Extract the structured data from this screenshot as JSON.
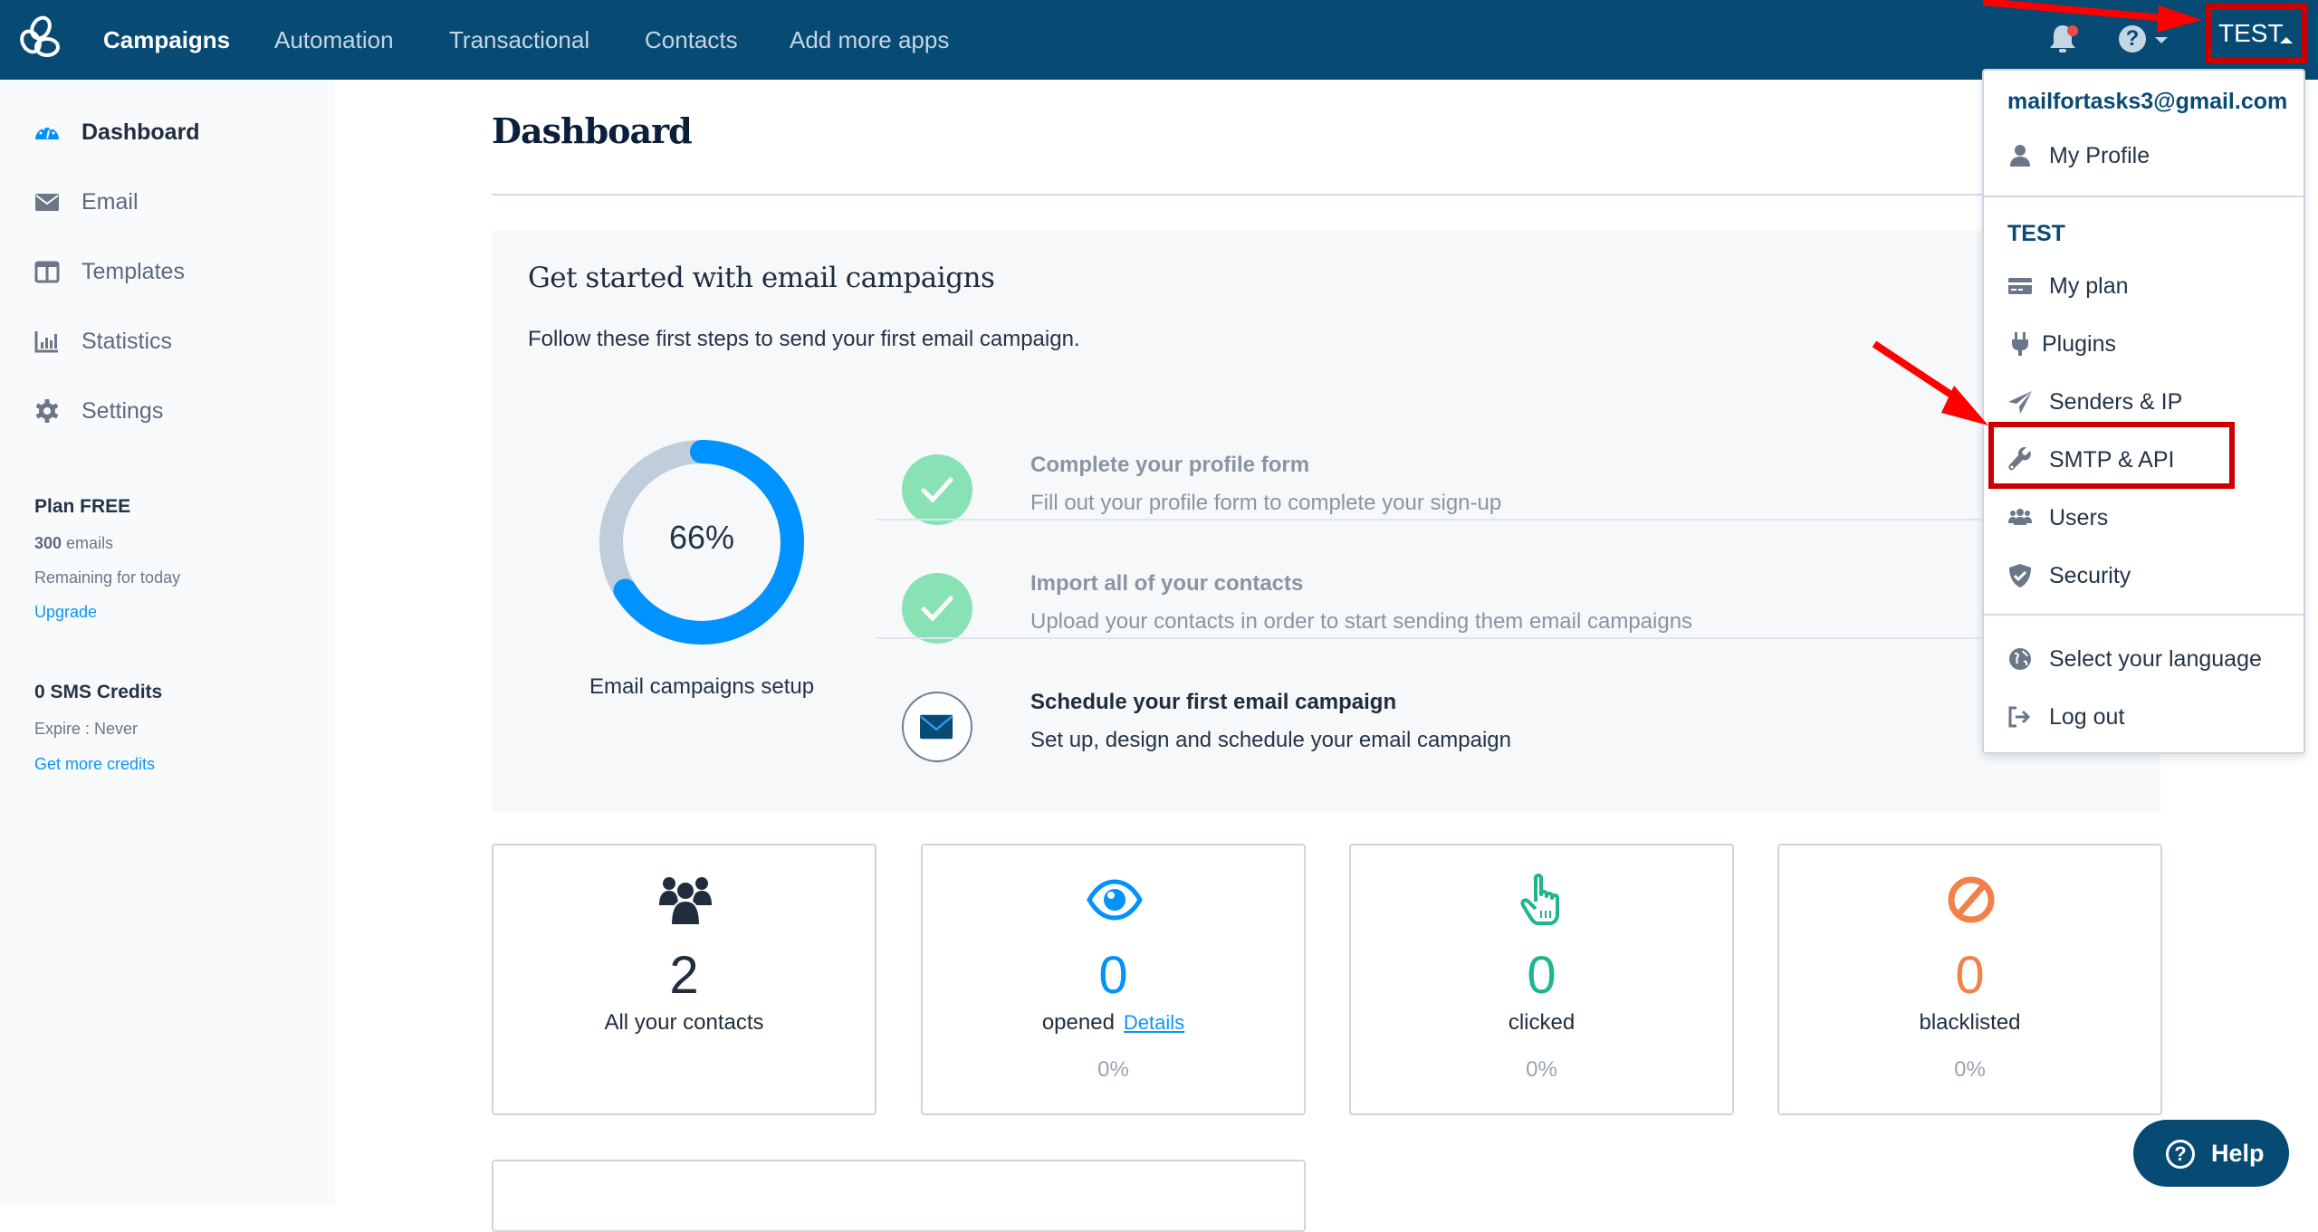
{
  "header": {
    "logo": "sendinblue-logo-icon",
    "nav": [
      {
        "label": "Campaigns",
        "active": true
      },
      {
        "label": "Automation",
        "active": false
      },
      {
        "label": "Transactional",
        "active": false
      },
      {
        "label": "Contacts",
        "active": false
      },
      {
        "label": "Add more apps",
        "active": false
      }
    ],
    "notifications_icon": "bell-icon",
    "help_icon": "question-circle-icon",
    "help_glyph": "?",
    "account_label": "TEST"
  },
  "sidebar": {
    "items": [
      {
        "label": "Dashboard",
        "icon": "dashboard-gauge-icon",
        "active": true
      },
      {
        "label": "Email",
        "icon": "envelope-icon",
        "active": false
      },
      {
        "label": "Templates",
        "icon": "columns-icon",
        "active": false
      },
      {
        "label": "Statistics",
        "icon": "bar-chart-icon",
        "active": false
      },
      {
        "label": "Settings",
        "icon": "gear-icon",
        "active": false
      }
    ],
    "plan": {
      "title": "Plan FREE",
      "emails_count": "300",
      "emails_unit": " emails",
      "remaining": "Remaining for today",
      "upgrade_link": "Upgrade"
    },
    "sms": {
      "title": "0 SMS Credits",
      "expire": "Expire : Never",
      "link": "Get more credits"
    }
  },
  "main": {
    "title": "Dashboard",
    "get_started": {
      "title": "Get started with email campaigns",
      "subtitle": "Follow these first steps to send your first email campaign.",
      "progress": {
        "percent": 66,
        "label_text": "66%",
        "caption": "Email campaigns setup",
        "fill_color": "#0092ff",
        "track_color": "#c0cddb"
      },
      "steps": [
        {
          "title": "Complete your profile form",
          "description": "Fill out your profile form to complete your sign-up",
          "status": "done",
          "icon": "check-icon"
        },
        {
          "title": "Import all of your contacts",
          "description": "Upload your contacts in order to start sending them email campaigns",
          "status": "done",
          "icon": "check-icon"
        },
        {
          "title": "Schedule your first email campaign",
          "description": "Set up, design and schedule your email campaign",
          "status": "todo",
          "icon": "envelope-icon"
        }
      ]
    },
    "stats": [
      {
        "value": "2",
        "label": "All your contacts",
        "percent": "",
        "link": "",
        "icon": "users-icon",
        "color": "#1f2d3d"
      },
      {
        "value": "0",
        "label": "opened",
        "percent": "0%",
        "link": "Details",
        "icon": "eye-icon",
        "color": "#0092ff"
      },
      {
        "value": "0",
        "label": "clicked",
        "percent": "0%",
        "link": "",
        "icon": "pointer-hand-icon",
        "color": "#1fb58f"
      },
      {
        "value": "0",
        "label": "blacklisted",
        "percent": "0%",
        "link": "",
        "icon": "ban-icon",
        "color": "#f28149"
      }
    ]
  },
  "account_menu": {
    "email": "mailfortasks3@gmail.com",
    "profile_label": "My Profile",
    "section_title": "TEST",
    "items": [
      {
        "label": "My plan",
        "icon": "credit-card-icon"
      },
      {
        "label": "Plugins",
        "icon": "plug-icon"
      },
      {
        "label": "Senders & IP",
        "icon": "paper-plane-icon"
      },
      {
        "label": "SMTP & API",
        "icon": "wrench-icon",
        "highlighted": true
      },
      {
        "label": "Users",
        "icon": "users-icon"
      },
      {
        "label": "Security",
        "icon": "shield-check-icon"
      }
    ],
    "footer_items": [
      {
        "label": "Select your language",
        "icon": "globe-icon"
      },
      {
        "label": "Log out",
        "icon": "sign-out-icon"
      }
    ]
  },
  "help_button": {
    "label": "Help",
    "glyph": "?"
  },
  "colors": {
    "header_bg": "#074a73",
    "accent_blue": "#0092ff",
    "annotation_red": "#cc0000"
  }
}
